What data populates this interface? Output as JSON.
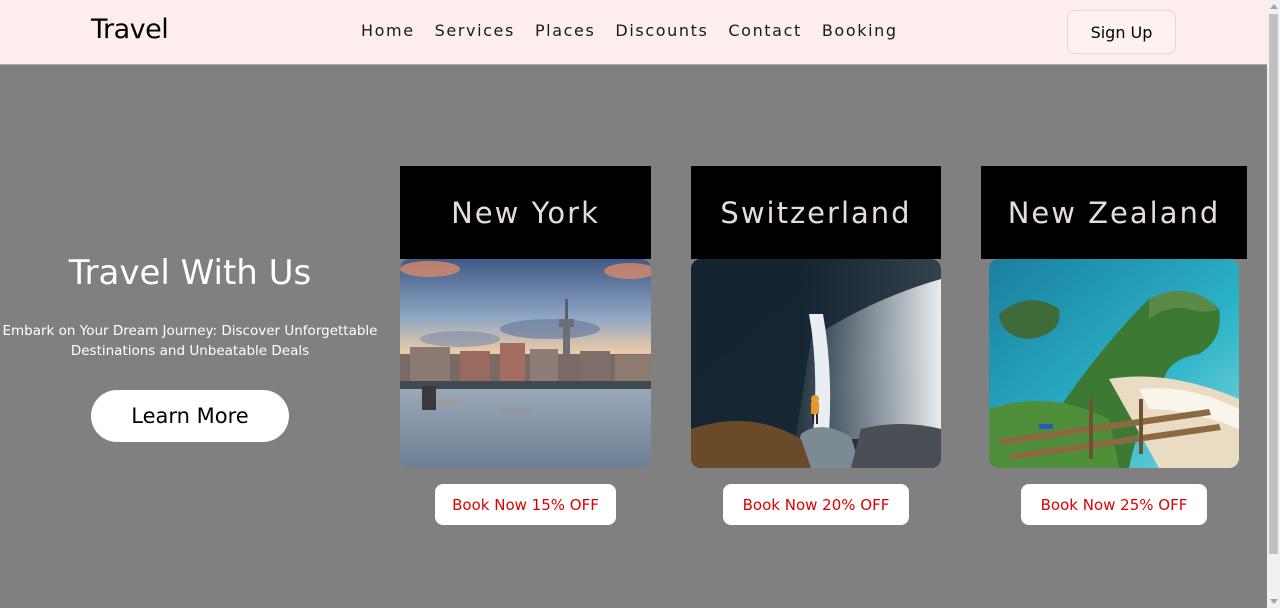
{
  "header": {
    "logo": "Travel",
    "nav": [
      "Home",
      "Services",
      "Places",
      "Discounts",
      "Contact",
      "Booking"
    ],
    "signup_label": "Sign Up"
  },
  "hero": {
    "title": "Travel With Us",
    "subtitle": "Embark on Your Dream Journey: Discover Unforgettable Destinations and Unbeatable Deals",
    "cta_label": "Learn More"
  },
  "cards": [
    {
      "title": "New York",
      "button": "Book Now 15% OFF"
    },
    {
      "title": "Switzerland",
      "button": "Book Now 20% OFF"
    },
    {
      "title": "New Zealand",
      "button": "Book Now 25% OFF"
    }
  ],
  "colors": {
    "header_bg": "#feeded",
    "page_bg": "#808080",
    "card_title_bg": "#000000",
    "discount_text": "#e00000"
  }
}
